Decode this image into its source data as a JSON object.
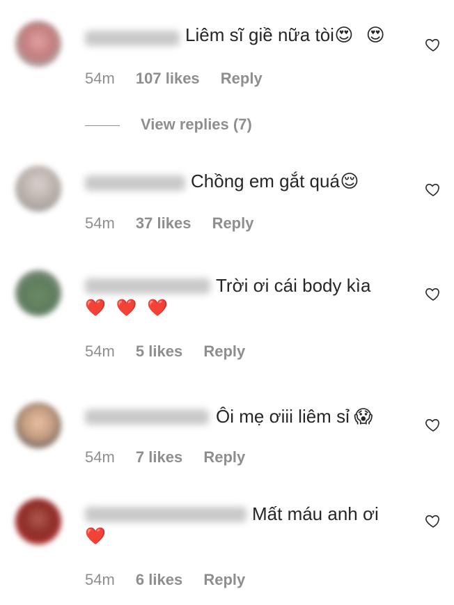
{
  "comments": [
    {
      "text": "Liêm sĩ giề nữa tòi",
      "trailing_emojis": [
        "😍",
        "😍"
      ],
      "second_line_emojis": [],
      "time": "54m",
      "likes": "107 likes",
      "reply": "Reply"
    },
    {
      "text": "Chồng em gắt quá",
      "trailing_emojis": [
        "😌"
      ],
      "second_line_emojis": [],
      "time": "54m",
      "likes": "37 likes",
      "reply": "Reply"
    },
    {
      "text": "Trời ơi cái body kìa",
      "trailing_emojis": [],
      "second_line_emojis": [
        "❤️",
        "❤️",
        "❤️"
      ],
      "time": "54m",
      "likes": "5 likes",
      "reply": "Reply"
    },
    {
      "text": "Ôi mẹ ơiii liêm sỉ",
      "trailing_emojis": [
        "😱"
      ],
      "second_line_emojis": [],
      "time": "54m",
      "likes": "7 likes",
      "reply": "Reply"
    },
    {
      "text": "Mất máu anh ơi",
      "trailing_emojis": [],
      "second_line_emojis": [
        "❤️"
      ],
      "time": "54m",
      "likes": "6 likes",
      "reply": "Reply"
    }
  ],
  "view_replies": "View replies (7)",
  "icons": {
    "like": "heart-outline-icon"
  },
  "colors": {
    "text": "#262626",
    "meta": "#8e8e8e"
  }
}
